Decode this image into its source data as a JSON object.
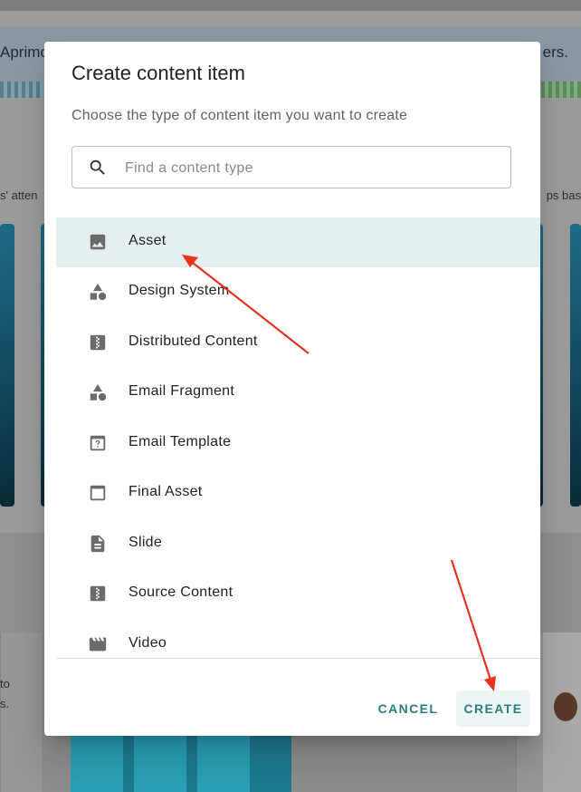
{
  "background": {
    "banner_text_left": "Aprimo",
    "banner_text_right": "ers.",
    "side_text_left": "s' atten",
    "side_text_right": "ps bas",
    "tile_text_lines": [
      "to",
      "s."
    ]
  },
  "dialog": {
    "title": "Create content item",
    "subtitle": "Choose the type of content item you want to create",
    "search": {
      "placeholder": "Find a content type",
      "value": "",
      "icon": "search-icon"
    },
    "items": [
      {
        "label": "Asset",
        "icon": "image-icon",
        "selected": true
      },
      {
        "label": "Design System",
        "icon": "shapes-icon",
        "selected": false
      },
      {
        "label": "Distributed Content",
        "icon": "zip-file-icon",
        "selected": false
      },
      {
        "label": "Email Fragment",
        "icon": "shapes-icon",
        "selected": false
      },
      {
        "label": "Email Template",
        "icon": "template-icon",
        "selected": false
      },
      {
        "label": "Final Asset",
        "icon": "window-icon",
        "selected": false
      },
      {
        "label": "Slide",
        "icon": "document-icon",
        "selected": false
      },
      {
        "label": "Source Content",
        "icon": "zip-file-icon",
        "selected": false
      },
      {
        "label": "Video",
        "icon": "movie-icon",
        "selected": false
      }
    ],
    "actions": {
      "cancel_label": "CANCEL",
      "create_label": "CREATE"
    }
  },
  "colors": {
    "accent": "#2a7f80",
    "selected_row": "#e5efef",
    "annotation_arrow": "#e8321e"
  }
}
